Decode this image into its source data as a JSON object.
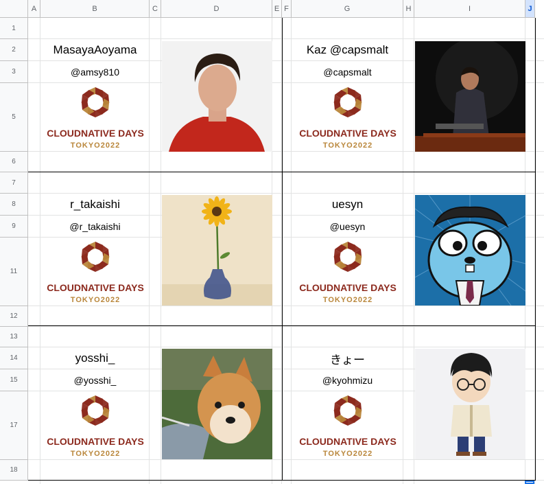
{
  "sheet": {
    "columns": [
      "A",
      "B",
      "C",
      "D",
      "E",
      "F",
      "G",
      "H",
      "I",
      "J"
    ],
    "selected_column": "J",
    "rows": [
      "1",
      "2",
      "3",
      "5",
      "6",
      "7",
      "8",
      "9",
      "11",
      "12",
      "13",
      "14",
      "15",
      "17",
      "18"
    ]
  },
  "logo": {
    "line1": "CLOUDNATIVE DAYS",
    "line2": "TOKYO2022",
    "primary_color": "#8c2a1e",
    "accent_color": "#b9863a"
  },
  "entries": [
    {
      "name": "MasayaAoyama",
      "handle": "@amsy810",
      "photo": "portrait-man-red-sweater"
    },
    {
      "name": "Kaz @capsmalt",
      "handle": "@capsmalt",
      "photo": "speaker-at-podium"
    },
    {
      "name": "r_takaishi",
      "handle": "@r_takaishi",
      "photo": "sunflower-in-vase"
    },
    {
      "name": "uesyn",
      "handle": "@uesyn",
      "photo": "gopher-cartoon"
    },
    {
      "name": "yosshi_",
      "handle": "@yosshi_",
      "photo": "shiba-dog"
    },
    {
      "name": "きょー",
      "handle": "@kyohmizu",
      "photo": "cartoon-boy-glasses"
    }
  ]
}
